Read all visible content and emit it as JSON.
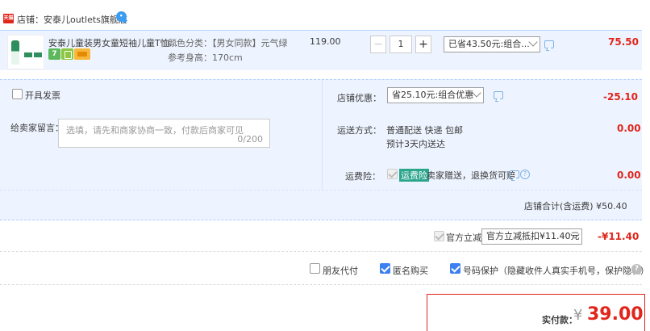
{
  "store": {
    "badge_text": "天猫",
    "name": "店铺：安泰儿outlets旗舰店",
    "chat_icon": "wangwang-chat-icon"
  },
  "item": {
    "title": "安泰儿童装男女童短袖儿童T恤...",
    "badge_1": "7",
    "spec_color": "颜色分类：【男女同款】元气绿",
    "spec_size": "参考身高：170cm",
    "unit_price": "119.00",
    "quantity": "1",
    "minus": "−",
    "plus": "+",
    "discount_select": "已省43.50元:组合...",
    "subtotal": "75.50"
  },
  "options": {
    "invoice_label": "开具发票",
    "note_label": "给卖家留言：",
    "note_placeholder": "选填，请先和商家协商一致，付款后商家可见",
    "note_counter": "0/200",
    "store_discount_label": "店铺优惠：",
    "store_discount_select": "省25.10元:组合优惠",
    "store_discount_value": "-25.10",
    "shipping_label": "运送方式：",
    "shipping_method": "普通配送 快递 包邮",
    "shipping_eta": "预计3天内送达",
    "shipping_value": "0.00",
    "insurance_label": "运费险：",
    "insurance_tag": "运费险",
    "insurance_text": "卖家赠送，退换货可赔",
    "insurance_value": "0.00",
    "store_total": "店铺合计(含运费)  ¥50.40"
  },
  "official": {
    "label": "官方立减",
    "select": "官方立减抵扣¥11.40元",
    "value": "-¥11.40"
  },
  "extras": {
    "friend_pay": "朋友代付",
    "anonymous": "匿名购买",
    "phone_protect": "号码保护（隐藏收件人真实手机号，保护隐私）",
    "help": "?"
  },
  "payment": {
    "label": "实付款：",
    "currency": "¥",
    "amount": "39.00"
  },
  "colors": {
    "accent_red": "#e1251b",
    "row_bg": "#eef4ff",
    "checkbox_blue": "#3c7ff0"
  }
}
